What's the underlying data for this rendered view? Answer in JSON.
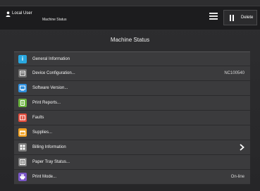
{
  "header": {
    "user_label": "Local User",
    "breadcrumb": "Machine Status",
    "menu_icon": "hamburger-menu-icon",
    "delete_label": "Delete",
    "pause_icon": "pause-icon"
  },
  "page": {
    "title": "Machine Status"
  },
  "items": [
    {
      "label": "General Information",
      "value": "",
      "icon": "info-icon",
      "icon_color": "#29a7df",
      "chevron": false
    },
    {
      "label": "Device Configuration...",
      "value": "NC100540",
      "icon": "device-icon",
      "icon_color": "#6a6a6a",
      "chevron": false
    },
    {
      "label": "Software Version...",
      "value": "",
      "icon": "software-icon",
      "icon_color": "#2f8fdc",
      "chevron": false
    },
    {
      "label": "Print Reports...",
      "value": "",
      "icon": "report-icon",
      "icon_color": "#6bb43f",
      "chevron": false
    },
    {
      "label": "Faults",
      "value": "",
      "icon": "faults-icon",
      "icon_color": "#e24b3b",
      "chevron": false
    },
    {
      "label": "Supplies...",
      "value": "",
      "icon": "supplies-icon",
      "icon_color": "#f0a020",
      "chevron": false
    },
    {
      "label": "Billing Information",
      "value": "",
      "icon": "billing-icon",
      "icon_color": "#7a7a7a",
      "chevron": true
    },
    {
      "label": "Paper Tray Status...",
      "value": "",
      "icon": "paper-tray-icon",
      "icon_color": "#7a7a7a",
      "chevron": false
    },
    {
      "label": "Print Mode...",
      "value": "On-line",
      "icon": "print-mode-icon",
      "icon_color": "#7b57c8",
      "chevron": false
    }
  ]
}
